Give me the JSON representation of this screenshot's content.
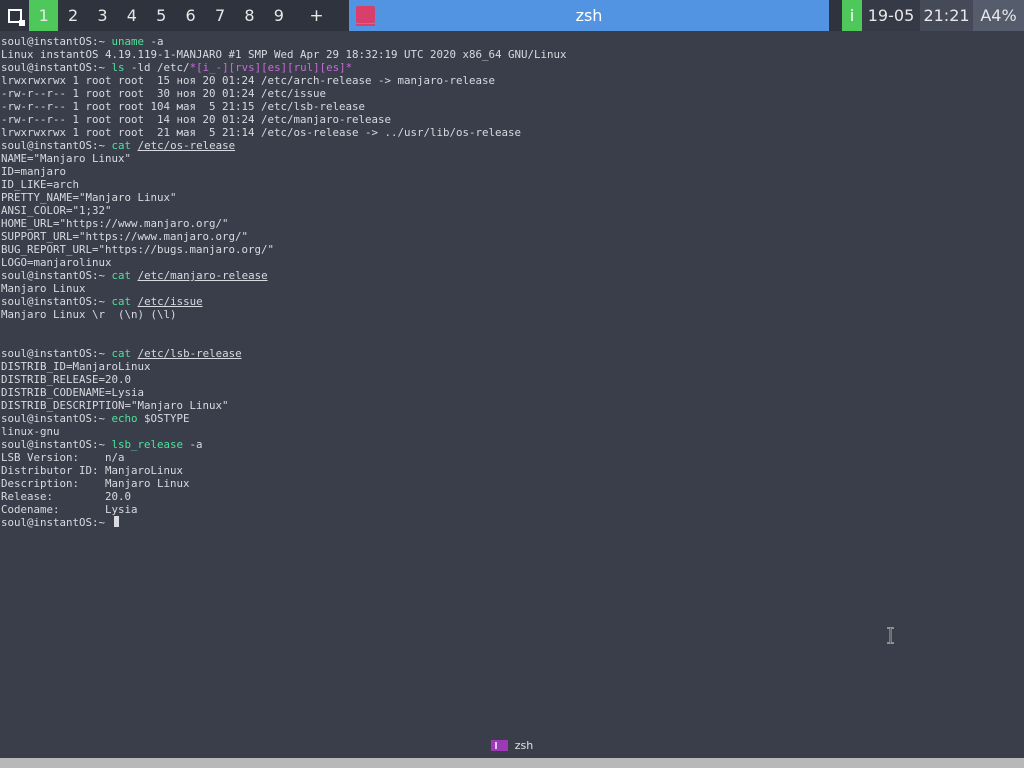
{
  "topbar": {
    "tags": [
      "1",
      "2",
      "3",
      "4",
      "5",
      "6",
      "7",
      "8",
      "9"
    ],
    "active_tag": "1",
    "add_tag_label": "+",
    "window_title": "zsh",
    "status_i": "i",
    "date": "19-05",
    "time": "21:21",
    "volume": "A4%"
  },
  "terminal": {
    "prompt": "soul@instantOS:~",
    "lines": [
      {
        "type": "prompt",
        "cmd": "uname",
        "args": " -a"
      },
      {
        "type": "out",
        "text": "Linux instantOS 4.19.119-1-MANJARO #1 SMP Wed Apr 29 18:32:19 UTC 2020 x86_64 GNU/Linux"
      },
      {
        "type": "prompt",
        "cmd": "ls",
        "args": " -ld /etc/",
        "glob": "*[i_-][rvs][es][rul][es]*"
      },
      {
        "type": "out",
        "text": "lrwxrwxrwx 1 root root  15 ноя 20 01:24 /etc/arch-release -> manjaro-release"
      },
      {
        "type": "out",
        "text": "-rw-r--r-- 1 root root  30 ноя 20 01:24 /etc/issue"
      },
      {
        "type": "out",
        "text": "-rw-r--r-- 1 root root 104 мая  5 21:15 /etc/lsb-release"
      },
      {
        "type": "out",
        "text": "-rw-r--r-- 1 root root  14 ноя 20 01:24 /etc/manjaro-release"
      },
      {
        "type": "out",
        "text": "lrwxrwxrwx 1 root root  21 мая  5 21:14 /etc/os-release -> ../usr/lib/os-release"
      },
      {
        "type": "prompt",
        "cmd": "cat",
        "args": " ",
        "path": "/etc/os-release"
      },
      {
        "type": "out",
        "text": "NAME=\"Manjaro Linux\""
      },
      {
        "type": "out",
        "text": "ID=manjaro"
      },
      {
        "type": "out",
        "text": "ID_LIKE=arch"
      },
      {
        "type": "out",
        "text": "PRETTY_NAME=\"Manjaro Linux\""
      },
      {
        "type": "out",
        "text": "ANSI_COLOR=\"1;32\""
      },
      {
        "type": "out",
        "text": "HOME_URL=\"https://www.manjaro.org/\""
      },
      {
        "type": "out",
        "text": "SUPPORT_URL=\"https://www.manjaro.org/\""
      },
      {
        "type": "out",
        "text": "BUG_REPORT_URL=\"https://bugs.manjaro.org/\""
      },
      {
        "type": "out",
        "text": "LOGO=manjarolinux"
      },
      {
        "type": "prompt",
        "cmd": "cat",
        "args": " ",
        "path": "/etc/manjaro-release"
      },
      {
        "type": "out",
        "text": "Manjaro Linux"
      },
      {
        "type": "prompt",
        "cmd": "cat",
        "args": " ",
        "path": "/etc/issue"
      },
      {
        "type": "out",
        "text": "Manjaro Linux \\r  (\\n) (\\l)"
      },
      {
        "type": "out",
        "text": ""
      },
      {
        "type": "out",
        "text": ""
      },
      {
        "type": "prompt",
        "cmd": "cat",
        "args": " ",
        "path": "/etc/lsb-release"
      },
      {
        "type": "out",
        "text": "DISTRIB_ID=ManjaroLinux"
      },
      {
        "type": "out",
        "text": "DISTRIB_RELEASE=20.0"
      },
      {
        "type": "out",
        "text": "DISTRIB_CODENAME=Lysia"
      },
      {
        "type": "out",
        "text": "DISTRIB_DESCRIPTION=\"Manjaro Linux\""
      },
      {
        "type": "prompt",
        "cmd": "echo",
        "args": " $OSTYPE"
      },
      {
        "type": "out",
        "text": "linux-gnu"
      },
      {
        "type": "prompt",
        "cmd": "lsb_release",
        "args": " -a"
      },
      {
        "type": "out",
        "text": "LSB Version:    n/a"
      },
      {
        "type": "out",
        "text": "Distributor ID: ManjaroLinux"
      },
      {
        "type": "out",
        "text": "Description:    Manjaro Linux"
      },
      {
        "type": "out",
        "text": "Release:        20.0"
      },
      {
        "type": "out",
        "text": "Codename:       Lysia"
      },
      {
        "type": "prompt",
        "cmd": "",
        "args": "",
        "cursor": true
      }
    ]
  },
  "taskbar": {
    "task_label": "zsh"
  }
}
